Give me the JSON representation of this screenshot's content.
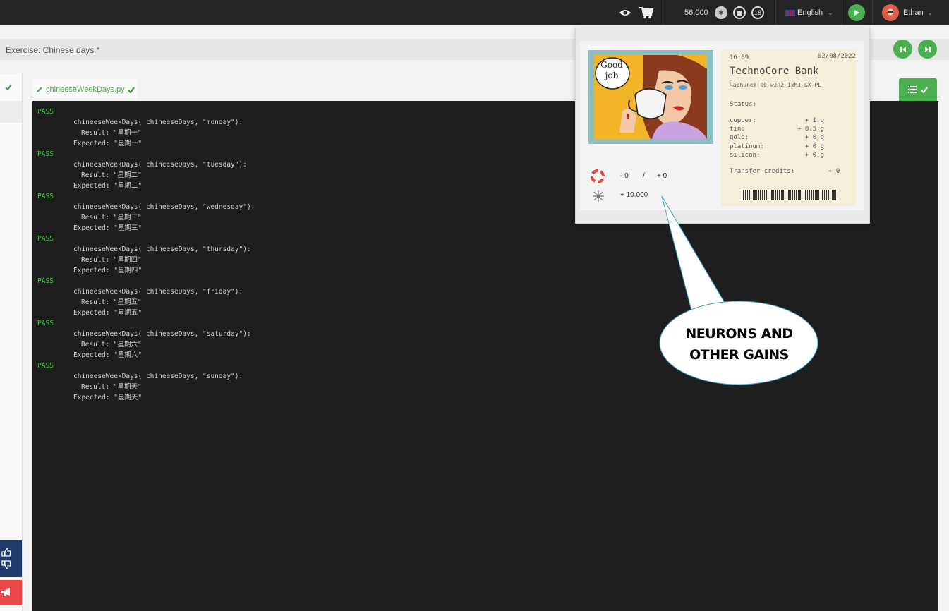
{
  "topbar": {
    "neurons": "56,000",
    "credits_badge": "18",
    "language": "English",
    "user": "Ethan"
  },
  "exercise": {
    "title": "Exercise: Chinese days *"
  },
  "file_tab": {
    "name": "chineeseWeekDays.py"
  },
  "console": {
    "tests": [
      {
        "status": "PASS",
        "call": "chineeseWeekDays( chineeseDays, \"monday\"):",
        "result": "Result: \"星期一\"",
        "expected": "Expected: \"星期一\""
      },
      {
        "status": "PASS",
        "call": "chineeseWeekDays( chineeseDays, \"tuesday\"):",
        "result": "Result: \"星期二\"",
        "expected": "Expected: \"星期二\""
      },
      {
        "status": "PASS",
        "call": "chineeseWeekDays( chineeseDays, \"wednesday\"):",
        "result": "Result: \"星期三\"",
        "expected": "Expected: \"星期三\""
      },
      {
        "status": "PASS",
        "call": "chineeseWeekDays( chineeseDays, \"thursday\"):",
        "result": "Result: \"星期四\"",
        "expected": "Expected: \"星期四\""
      },
      {
        "status": "PASS",
        "call": "chineeseWeekDays( chineeseDays, \"friday\"):",
        "result": "Result: \"星期五\"",
        "expected": "Expected: \"星期五\""
      },
      {
        "status": "PASS",
        "call": "chineeseWeekDays( chineeseDays, \"saturday\"):",
        "result": "Result: \"星期六\"",
        "expected": "Expected: \"星期六\""
      },
      {
        "status": "PASS",
        "call": "chineeseWeekDays( chineeseDays, \"sunday\"):",
        "result": "Result: \"星期天\"",
        "expected": "Expected: \"星期天\""
      }
    ]
  },
  "popup": {
    "comic_text_1": "Good",
    "comic_text_2": "job",
    "lives_minus": "- 0",
    "lives_sep": "/",
    "lives_plus": "+ 0",
    "neurons_gain": "+ 10.000",
    "receipt": {
      "time": "16:09",
      "date": "02/08/2022",
      "bank": "TechnoCore Bank",
      "account": "Rachunek 00-wJR2-1xMJ-GX-PL",
      "status_label": "Status:",
      "resources": [
        {
          "name": "copper:",
          "value": "+ 1 g"
        },
        {
          "name": "tin:",
          "value": "+ 0.5 g"
        },
        {
          "name": "gold:",
          "value": "+ 0 g"
        },
        {
          "name": "platinum:",
          "value": "+ 0 g"
        },
        {
          "name": "silicon:",
          "value": "+ 0 g"
        }
      ],
      "credits_label": "Transfer credits:",
      "credits_value": "+ 0"
    }
  },
  "bubble": {
    "line1": "NEURONS AND",
    "line2": "OTHER GAINS"
  },
  "colors": {
    "accent_green": "#4caf50",
    "topbar": "#252525",
    "console_bg": "#1e1e1e",
    "pass": "#3ec93e"
  }
}
